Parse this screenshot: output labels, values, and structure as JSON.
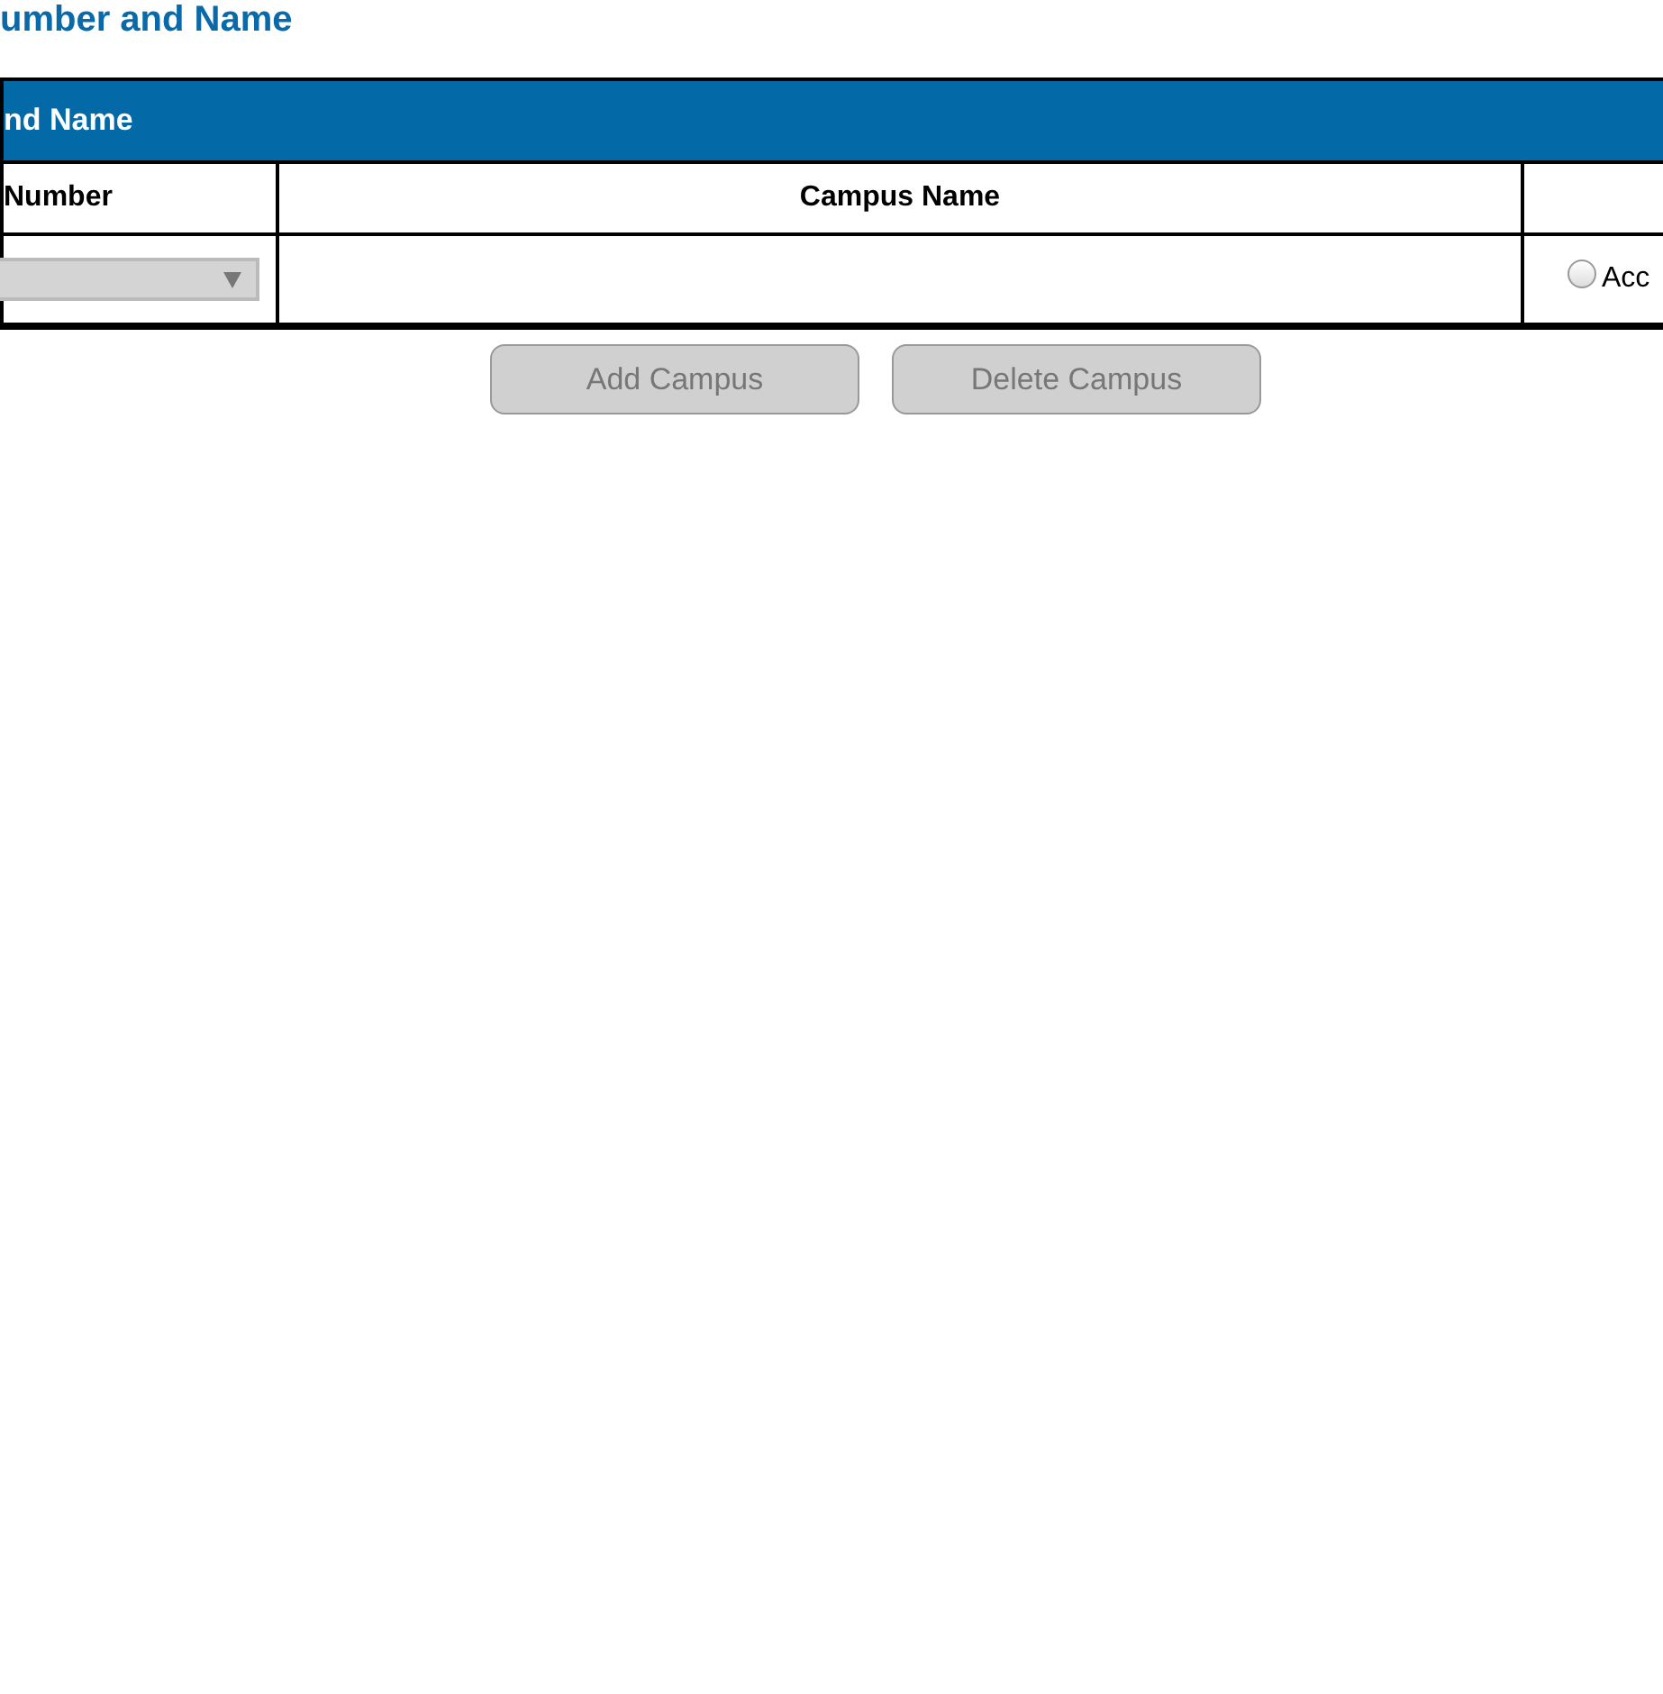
{
  "heading": "umber and Name",
  "panel": {
    "title": "nd Name",
    "columns": [
      "Number",
      "Campus Name"
    ],
    "rows": [
      {
        "number_select": {
          "disabled": true
        },
        "campus_name": "",
        "option": {
          "label": "Acc",
          "checked": false
        }
      }
    ]
  },
  "buttons": [
    {
      "label": "Add Campus",
      "disabled": true
    },
    {
      "label": "Delete Campus",
      "disabled": true
    }
  ]
}
